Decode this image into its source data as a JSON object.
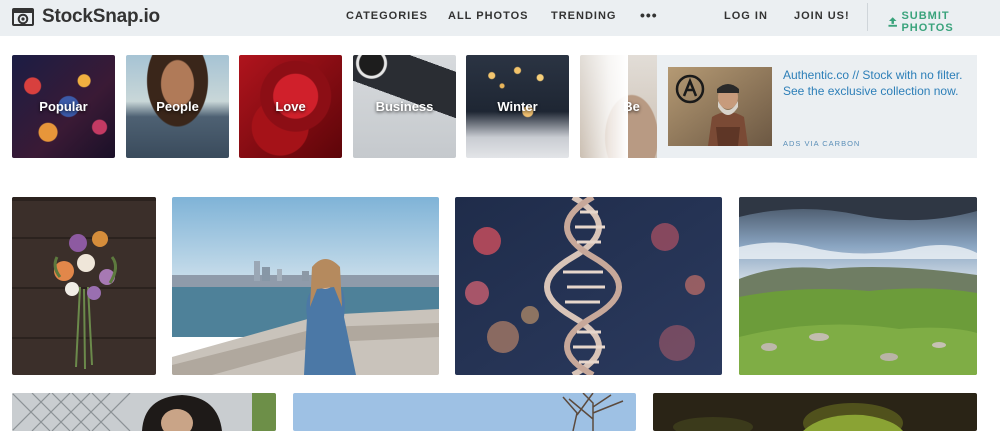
{
  "header": {
    "logo_text": "StockSnap.io",
    "nav": {
      "categories": "CATEGORIES",
      "all_photos": "ALL PHOTOS",
      "trending": "TRENDING",
      "more": "•••",
      "log_in": "LOG IN",
      "join_us": "JOIN US!"
    },
    "submit_label": "SUBMIT PHOTOS",
    "accent_color": "#3aa37c"
  },
  "categories": [
    {
      "label": "Popular"
    },
    {
      "label": "People"
    },
    {
      "label": "Love"
    },
    {
      "label": "Business"
    },
    {
      "label": "Winter"
    },
    {
      "label": "Be"
    }
  ],
  "ad": {
    "text": "Authentic.co // Stock with no filter. See the exclusive collection now.",
    "via": "ADS VIA CARBON",
    "link_color": "#2d7fb8"
  },
  "photos": [
    {
      "subject": "flower bouquet on dark wood"
    },
    {
      "subject": "woman in denim jacket by river"
    },
    {
      "subject": "DNA double helix"
    },
    {
      "subject": "green hills under cloudy sky"
    },
    {
      "subject": "woman by chain-link fence"
    },
    {
      "subject": "blue sky with bare tree"
    },
    {
      "subject": "green plant close-up"
    }
  ]
}
